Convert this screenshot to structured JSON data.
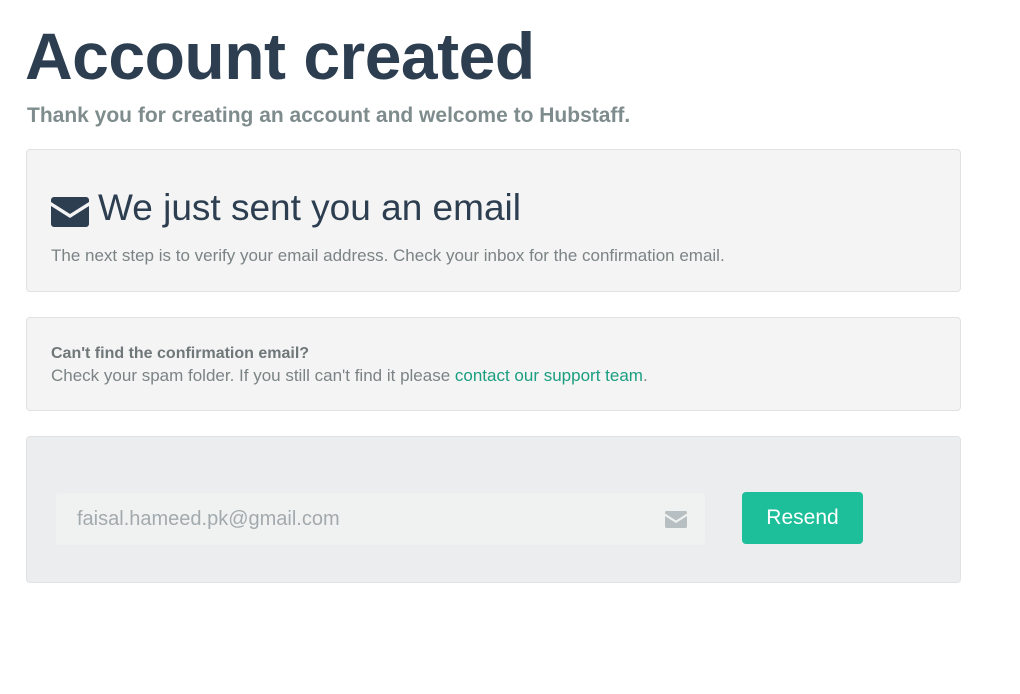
{
  "header": {
    "title": "Account created",
    "subtitle": "Thank you for creating an account and welcome to Hubstaff."
  },
  "email_notice": {
    "icon": "envelope-icon",
    "heading": "We just sent you an email",
    "description": "The next step is to verify your email address. Check your inbox for the confirmation email."
  },
  "help": {
    "question": "Can't find the confirmation email?",
    "text_before_link": "Check your spam folder. If you still can't find it please ",
    "link_label": "contact our support team",
    "text_after_link": "."
  },
  "resend": {
    "email_value": "faisal.hameed.pk@gmail.com",
    "input_icon": "envelope-icon",
    "button_label": "Resend"
  },
  "colors": {
    "heading": "#2c3e50",
    "accent": "#1cbf99",
    "link": "#1a9e80",
    "muted_text": "#7f8c8d"
  }
}
